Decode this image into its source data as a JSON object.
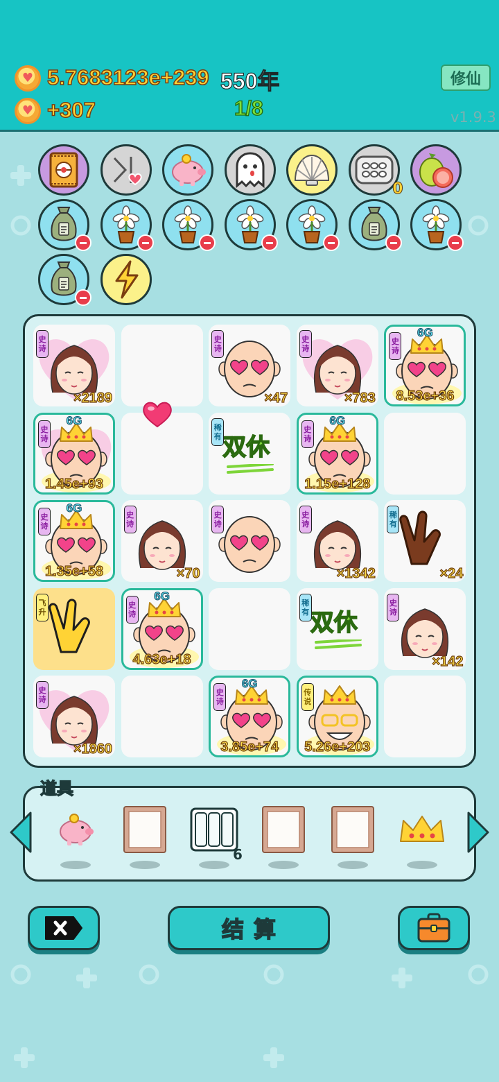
{
  "header": {
    "currency_amount": "5.7683123e+239",
    "years": "550年",
    "income": "+307",
    "progress": "1/8",
    "xiuxian_label": "修仙",
    "version": "v1.9.3"
  },
  "circle_items": [
    {
      "name": "snack-bag-icon",
      "color": "purple"
    },
    {
      "name": "skip-heart-icon",
      "color": "gray"
    },
    {
      "name": "piggy-bank-icon",
      "color": "blue"
    },
    {
      "name": "ghost-icon",
      "color": "gray"
    },
    {
      "name": "shell-icon",
      "color": "yellow"
    },
    {
      "name": "egg-tray-icon",
      "color": "gray",
      "badge": "0"
    },
    {
      "name": "pomelo-icon",
      "color": "purple"
    },
    {
      "name": "money-bag-icon",
      "color": "blue",
      "removable": true
    },
    {
      "name": "flower-pot-icon",
      "color": "blue",
      "removable": true
    },
    {
      "name": "flower-pot-icon",
      "color": "blue",
      "removable": true
    },
    {
      "name": "flower-pot-icon",
      "color": "blue",
      "removable": true
    },
    {
      "name": "flower-pot-icon",
      "color": "blue",
      "removable": true
    },
    {
      "name": "money-bag-icon",
      "color": "blue",
      "removable": true
    },
    {
      "name": "flower-pot-icon",
      "color": "blue",
      "removable": true
    },
    {
      "name": "money-bag-icon",
      "color": "blue",
      "removable": true
    },
    {
      "name": "lightning-icon",
      "color": "yellow"
    }
  ],
  "tags": {
    "epic": "史诗",
    "rare": "稀有",
    "legend": "传说",
    "fly": "飞升"
  },
  "grid": [
    [
      {
        "type": "girl-heart",
        "tag": "epic",
        "count": "×2189"
      },
      {
        "type": "empty"
      },
      {
        "type": "old-man",
        "tag": "epic",
        "count": "×47"
      },
      {
        "type": "girl-heart",
        "tag": "epic",
        "count": "×783"
      },
      {
        "type": "king",
        "tag": "epic",
        "count": "8.53e+36",
        "sixg": "6G"
      }
    ],
    [
      {
        "type": "king-heart",
        "tag": "epic",
        "count": "1.45e+93",
        "sixg": "6G"
      },
      {
        "type": "empty"
      },
      {
        "type": "shuangxiu",
        "tag": "rare",
        "label": "双休"
      },
      {
        "type": "king",
        "tag": "epic",
        "count": "1.15e+128",
        "sixg": "6G"
      },
      {
        "type": "empty"
      }
    ],
    [
      {
        "type": "king",
        "tag": "epic",
        "count": "1.35e+58",
        "sixg": "6G"
      },
      {
        "type": "girl",
        "tag": "epic",
        "count": "×70"
      },
      {
        "type": "old-man",
        "tag": "epic",
        "count": ""
      },
      {
        "type": "girl",
        "tag": "epic",
        "count": "×1342"
      },
      {
        "type": "brown-hand",
        "tag": "rare",
        "count": "×24"
      }
    ],
    [
      {
        "type": "yellow-hand",
        "tag": "fly",
        "count": ""
      },
      {
        "type": "king",
        "tag": "epic",
        "count": "4.63e+18",
        "sixg": "6G"
      },
      {
        "type": "empty"
      },
      {
        "type": "shuangxiu",
        "tag": "rare",
        "label": "双休"
      },
      {
        "type": "girl",
        "tag": "epic",
        "count": "×142"
      }
    ],
    [
      {
        "type": "girl-heart",
        "tag": "epic",
        "count": "×1860"
      },
      {
        "type": "empty"
      },
      {
        "type": "king",
        "tag": "epic",
        "count": "3.85e+74",
        "sixg": "6G"
      },
      {
        "type": "laughing-king",
        "tag": "legend",
        "count": "5.26e+203"
      },
      {
        "type": "empty"
      }
    ]
  ],
  "tools": {
    "label": "道具",
    "items": [
      {
        "name": "piggy-bank-icon"
      },
      {
        "name": "frame-icon"
      },
      {
        "name": "triple-slot-icon",
        "count": "6"
      },
      {
        "name": "frame-icon"
      },
      {
        "name": "frame-icon"
      },
      {
        "name": "crown-icon"
      }
    ]
  },
  "buttons": {
    "settle": "结算"
  }
}
